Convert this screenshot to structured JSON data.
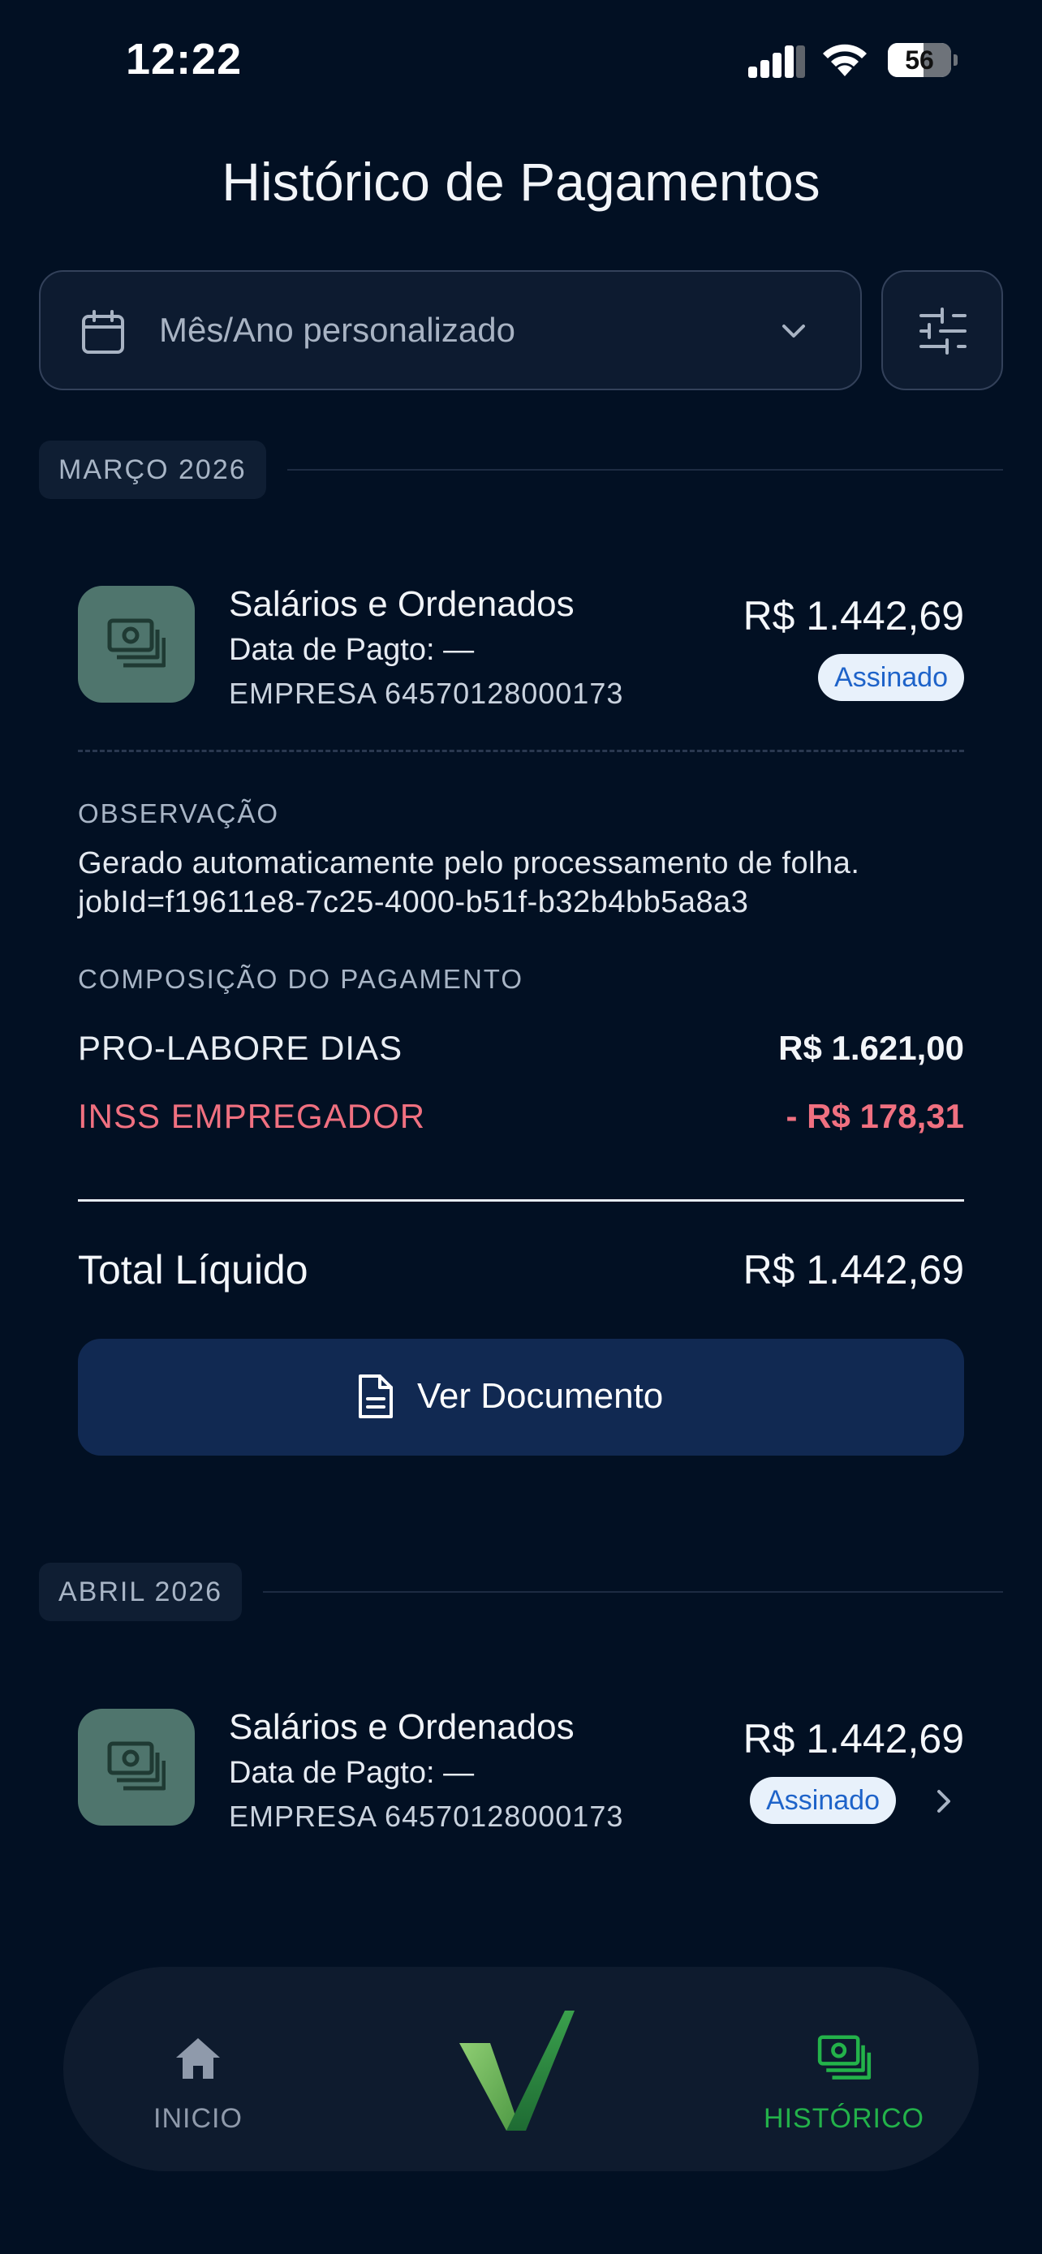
{
  "status_bar": {
    "time": "12:22",
    "battery": "56",
    "battery_level": 0.56
  },
  "header": {
    "title": "Histórico de Pagamentos"
  },
  "filter": {
    "month_placeholder": "Mês/Ano personalizado"
  },
  "sections": [
    {
      "label": "MARÇO 2026",
      "payment": {
        "title": "Salários e Ordenados",
        "date": "Data de Pagto: —",
        "company": "EMPRESA 64570128000173",
        "amount": "R$ 1.442,69",
        "status": "Assinado"
      },
      "details": {
        "observation_label": "OBSERVAÇÃO",
        "observation_line1": "Gerado automaticamente pelo processamento de folha.",
        "observation_line2": "jobId=f19611e8-7c25-4000-b51f-b32b4bb5a8a3",
        "composition_label": "COMPOSIÇÃO DO PAGAMENTO",
        "items": [
          {
            "label": "PRO-LABORE DIAS",
            "value": "R$ 1.621,00"
          },
          {
            "label": "INSS EMPREGADOR",
            "value": "- R$ 178,31"
          }
        ],
        "total_label": "Total Líquido",
        "total_value": "R$ 1.442,69",
        "document_button": "Ver Documento"
      }
    },
    {
      "label": "ABRIL 2026",
      "payment": {
        "title": "Salários e Ordenados",
        "date": "Data de Pagto: —",
        "company": "EMPRESA 64570128000173",
        "amount": "R$ 1.442,69",
        "status": "Assinado"
      }
    }
  ],
  "nav": {
    "home_label": "INICIO",
    "history_label": "HISTÓRICO",
    "active": "history"
  },
  "colors": {
    "background": "#021023",
    "accent_green": "#23b24a",
    "negative": "#f07080",
    "badge_text": "#1e63c9",
    "button": "#112952"
  }
}
